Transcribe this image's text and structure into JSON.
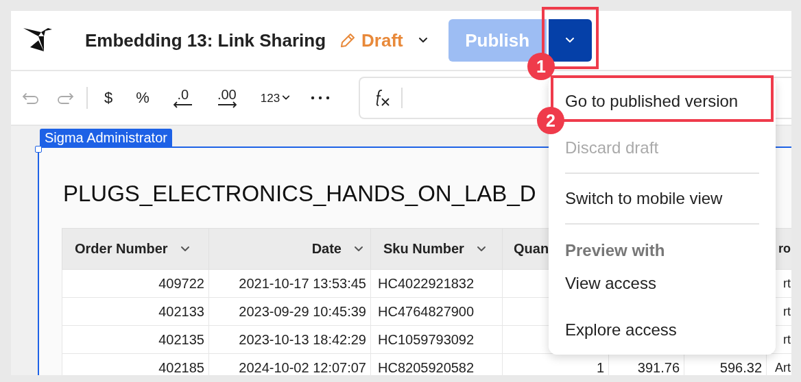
{
  "header": {
    "title": "Embedding 13: Link Sharing",
    "status": "Draft",
    "publish_button": "Publish",
    "publish_disabled": true
  },
  "toolbar": {
    "undo_disabled": true,
    "redo_disabled": true,
    "items": [
      {
        "kind": "text",
        "label": "$"
      },
      {
        "kind": "text",
        "label": "%"
      },
      {
        "kind": "decimal-decrease",
        "label": ".0"
      },
      {
        "kind": "decimal-increase",
        "label": ".00"
      },
      {
        "kind": "dropdown",
        "label": "123"
      },
      {
        "kind": "more"
      }
    ]
  },
  "element": {
    "badge": "Sigma Administrator",
    "title": "PLUGS_ELECTRONICS_HANDS_ON_LAB_D",
    "columns": {
      "order_number": {
        "label": "Order Number",
        "menu": true
      },
      "date": {
        "label": "Date",
        "menu": true
      },
      "sku_number": {
        "label": "Sku Number",
        "menu": true
      },
      "quantity": {
        "label": "Quan",
        "menu": false
      },
      "product": {
        "label": "ro",
        "menu": false
      }
    },
    "rows": [
      {
        "order_number": "409722",
        "date": "2021-10-17 13:53:45",
        "sku_number": "HC4022921832",
        "product": "rt"
      },
      {
        "order_number": "402133",
        "date": "2023-09-29 10:45:39",
        "sku_number": "HC4764827900",
        "product": "rt"
      },
      {
        "order_number": "402135",
        "date": "2023-10-13 18:42:29",
        "sku_number": "HC1059793092",
        "product": "rt"
      },
      {
        "order_number": "402185",
        "date": "2024-10-02 12:07:07",
        "sku_number": "HC8205920582",
        "quantity": "1",
        "column_5": "391.76",
        "column_6": "596.32",
        "product": "Art"
      }
    ]
  },
  "menu": {
    "items": [
      {
        "kind": "item",
        "label": "Go to published version",
        "disabled": false
      },
      {
        "kind": "item",
        "label": "Discard draft",
        "disabled": true
      },
      {
        "kind": "divider"
      },
      {
        "kind": "item",
        "label": "Switch to mobile view",
        "disabled": false
      },
      {
        "kind": "divider"
      },
      {
        "kind": "heading",
        "label": "Preview with"
      },
      {
        "kind": "item",
        "label": "View access",
        "disabled": false
      },
      {
        "kind": "item",
        "label": "Explore access",
        "disabled": false
      }
    ]
  },
  "annotations": [
    {
      "number": "1"
    },
    {
      "number": "2"
    }
  ]
}
